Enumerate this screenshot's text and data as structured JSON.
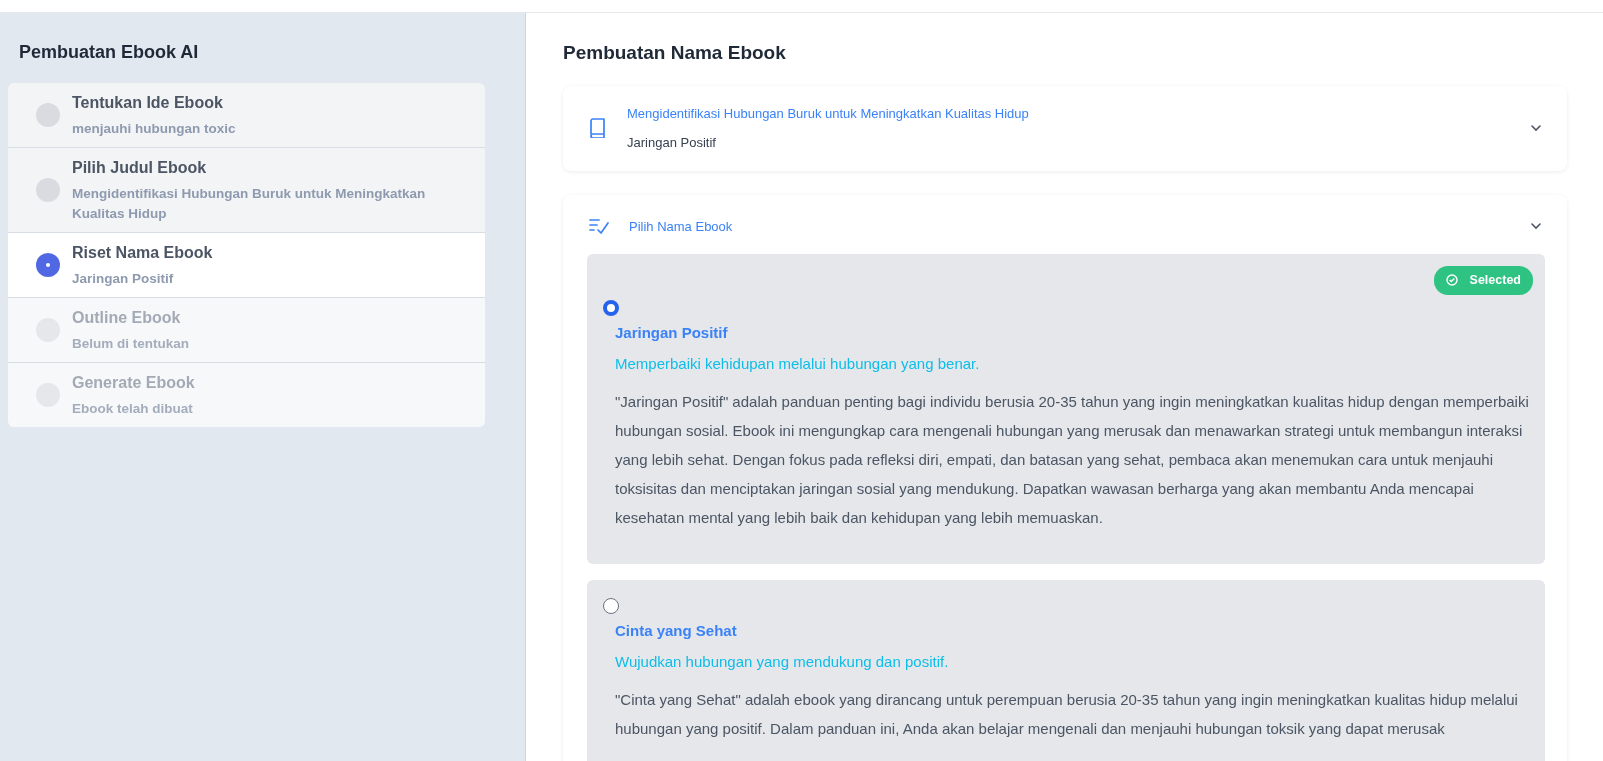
{
  "sidebar": {
    "title": "Pembuatan Ebook AI",
    "steps": [
      {
        "title": "Tentukan Ide Ebook",
        "subtitle": "menjauhi hubungan toxic",
        "selected": false,
        "disabled": false
      },
      {
        "title": "Pilih Judul Ebook",
        "subtitle": "Mengidentifikasi Hubungan Buruk untuk Meningkatkan Kualitas Hidup",
        "selected": false,
        "disabled": false
      },
      {
        "title": "Riset Nama Ebook",
        "subtitle": "Jaringan Positif",
        "selected": true,
        "disabled": false
      },
      {
        "title": "Outline Ebook",
        "subtitle": "Belum di tentukan",
        "selected": false,
        "disabled": true
      },
      {
        "title": "Generate Ebook",
        "subtitle": "Ebook telah dibuat",
        "selected": false,
        "disabled": true
      }
    ]
  },
  "main": {
    "title": "Pembuatan Nama Ebook",
    "summary_panel": {
      "label": "Mengidentifikasi Hubungan Buruk untuk Meningkatkan Kualitas Hidup",
      "value": "Jaringan Positif"
    },
    "choice_panel": {
      "label": "Pilih Nama Ebook",
      "options": [
        {
          "selected": true,
          "badge": "Selected",
          "name": "Jaringan Positif",
          "tagline": "Memperbaiki kehidupan melalui hubungan yang benar.",
          "description": "\"Jaringan Positif\" adalah panduan penting bagi individu berusia 20-35 tahun yang ingin meningkatkan kualitas hidup dengan memperbaiki hubungan sosial. Ebook ini mengungkap cara mengenali hubungan yang merusak dan menawarkan strategi untuk membangun interaksi yang lebih sehat. Dengan fokus pada refleksi diri, empati, dan batasan yang sehat, pembaca akan menemukan cara untuk menjauhi toksisitas dan menciptakan jaringan sosial yang mendukung. Dapatkan wawasan berharga yang akan membantu Anda mencapai kesehatan mental yang lebih baik dan kehidupan yang lebih memuaskan."
        },
        {
          "selected": false,
          "name": "Cinta yang Sehat",
          "tagline": "Wujudkan hubungan yang mendukung dan positif.",
          "description": "\"Cinta yang Sehat\" adalah ebook yang dirancang untuk perempuan berusia 20-35 tahun yang ingin meningkatkan kualitas hidup melalui hubungan yang positif. Dalam panduan ini, Anda akan belajar mengenali dan menjauhi hubungan toksik yang dapat merusak"
        }
      ]
    }
  }
}
